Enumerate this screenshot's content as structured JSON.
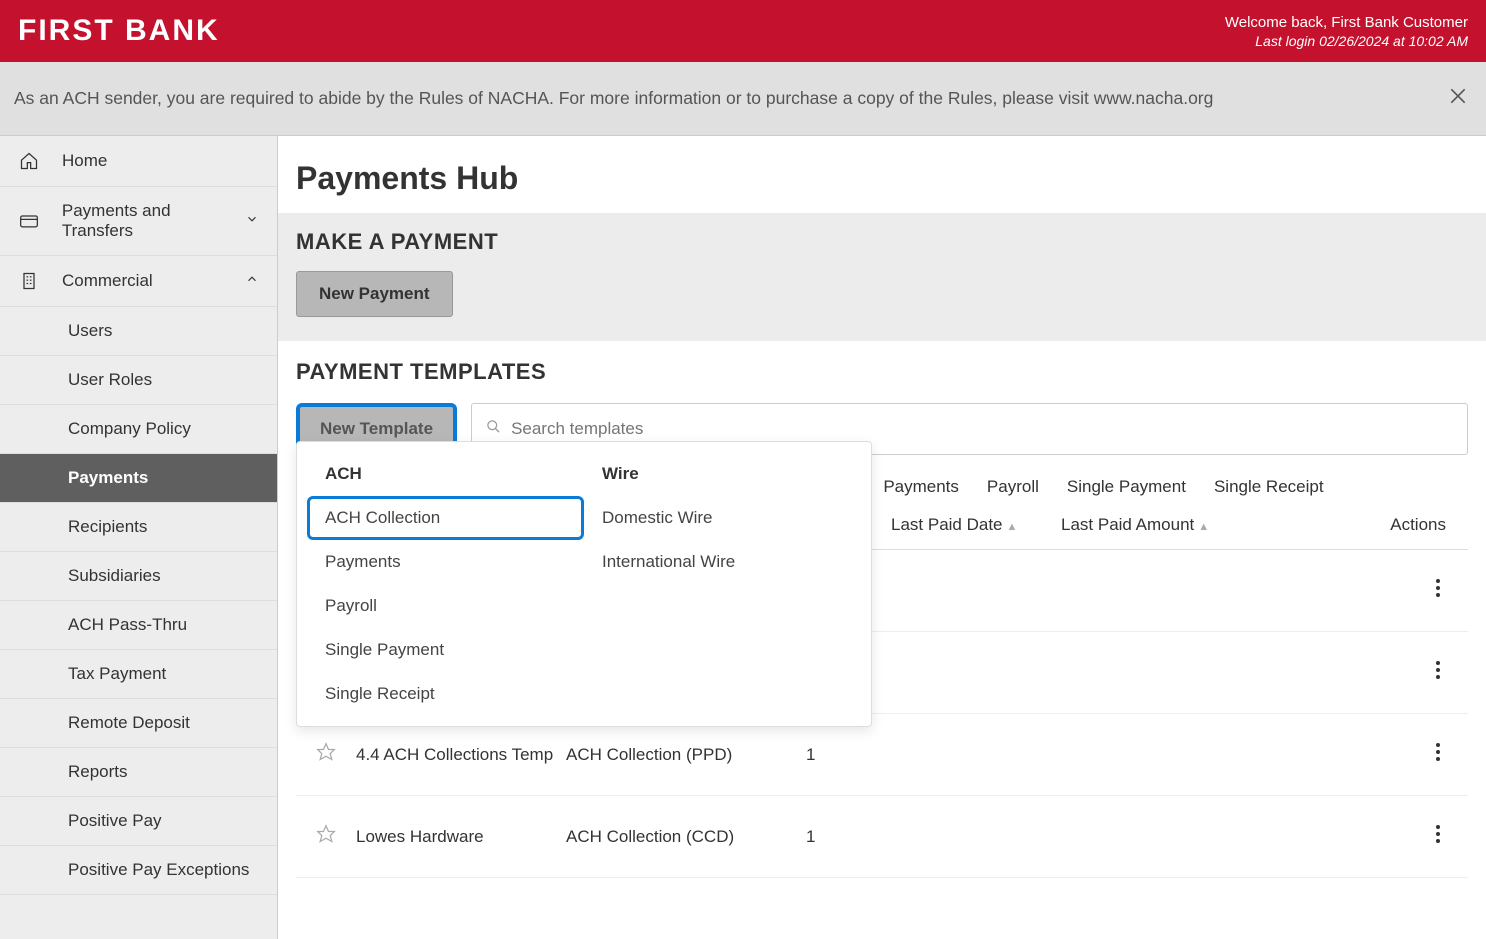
{
  "header": {
    "logo": "FIRST BANK",
    "welcome": "Welcome back, First Bank Customer",
    "last_login": "Last login 02/26/2024 at 10:02 AM"
  },
  "notice": {
    "text": "As an ACH sender, you are required to abide by the Rules of NACHA. For more information or to purchase a copy of the Rules, please visit www.nacha.org"
  },
  "sidebar": {
    "home": "Home",
    "payments_transfers": "Payments and Transfers",
    "commercial": "Commercial",
    "sub": {
      "users": "Users",
      "user_roles": "User Roles",
      "company_policy": "Company Policy",
      "payments": "Payments",
      "recipients": "Recipients",
      "subsidiaries": "Subsidiaries",
      "ach_pass": "ACH Pass-Thru",
      "tax_payment": "Tax Payment",
      "remote_deposit": "Remote Deposit",
      "reports": "Reports",
      "positive_pay": "Positive Pay",
      "positive_pay_exc": "Positive Pay Exceptions"
    }
  },
  "main": {
    "title": "Payments Hub",
    "make_payment_head": "MAKE A PAYMENT",
    "new_payment_btn": "New Payment",
    "templates_head": "PAYMENT TEMPLATES",
    "new_template_btn": "New Template",
    "search_placeholder": "Search templates"
  },
  "dropdown": {
    "ach_header": "ACH",
    "wire_header": "Wire",
    "ach": {
      "collection": "ACH Collection",
      "payments": "Payments",
      "payroll": "Payroll",
      "single_payment": "Single Payment",
      "single_receipt": "Single Receipt"
    },
    "wire": {
      "domestic": "Domestic Wire",
      "international": "International Wire"
    }
  },
  "filters": {
    "payments": "Payments",
    "payroll": "Payroll",
    "single_payment": "Single Payment",
    "single_receipt": "Single Receipt"
  },
  "table": {
    "head": {
      "last_paid_date": "Last Paid Date",
      "last_paid_amount": "Last Paid Amount",
      "actions": "Actions"
    },
    "rows": [
      {
        "star": false,
        "name": "",
        "type": "",
        "recipients": "",
        "date": "",
        "amount": ""
      },
      {
        "star": false,
        "name": "",
        "type": "",
        "recipients": "",
        "date": "",
        "amount": ""
      },
      {
        "star": false,
        "name": "4.4 ACH Collections Temp",
        "type": "ACH Collection (PPD)",
        "recipients": "1",
        "date": "",
        "amount": ""
      },
      {
        "star": false,
        "name": "Lowes Hardware",
        "type": "ACH Collection (CCD)",
        "recipients": "1",
        "date": "",
        "amount": ""
      }
    ]
  }
}
